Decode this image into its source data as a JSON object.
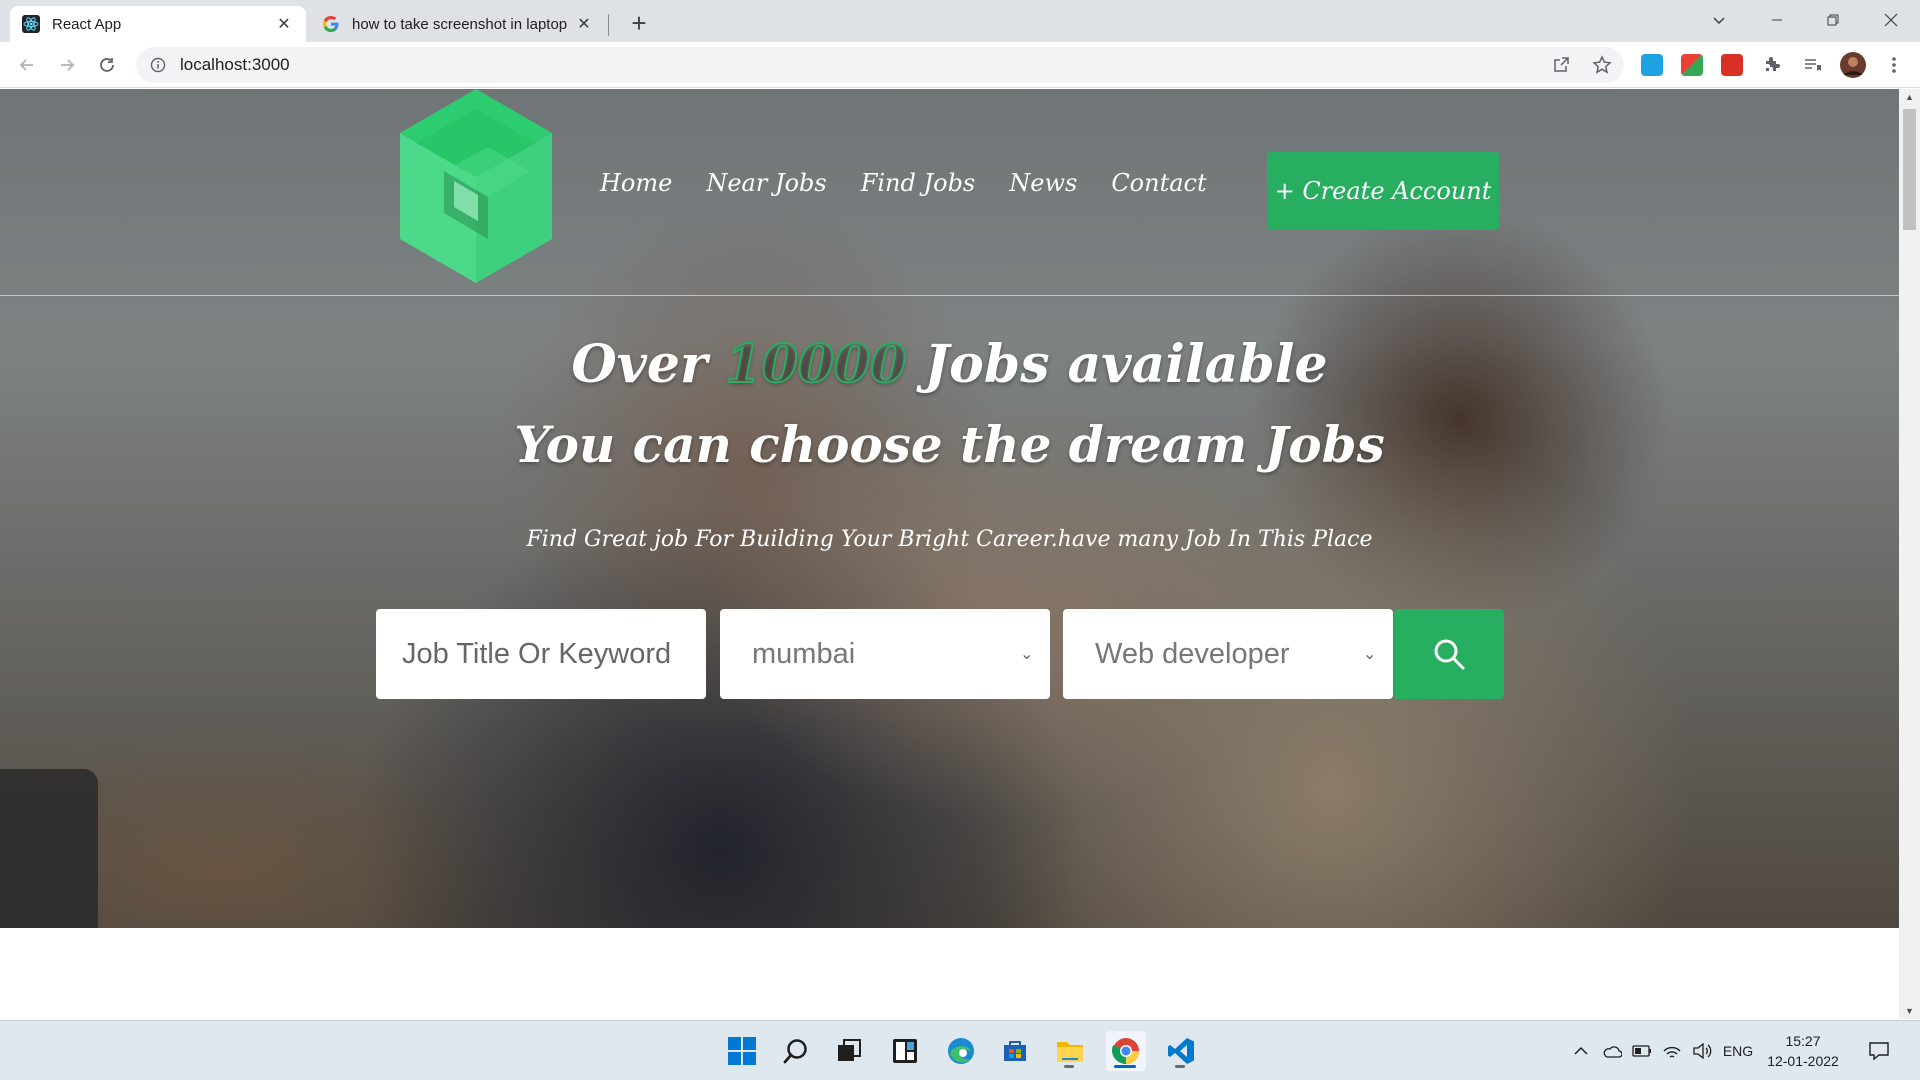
{
  "browser": {
    "tabs": [
      {
        "title": "React App",
        "active": true
      },
      {
        "title": "how to take screenshot in laptop",
        "active": false
      }
    ],
    "url": "localhost:3000"
  },
  "site": {
    "nav": [
      "Home",
      "Near Jobs",
      "Find Jobs",
      "News",
      "Contact"
    ],
    "create_account": "+ Create Account",
    "headline_pre": "Over ",
    "headline_number": "10000",
    "headline_post": " Jobs available",
    "subheadline": "You can choose the dream Jobs",
    "tagline": "Find Great job For Building Your Bright Career.have many Job In This Place",
    "search": {
      "keyword_placeholder": "Job Title Or Keyword",
      "location_value": "mumbai",
      "category_value": "Web developer"
    },
    "colors": {
      "accent": "#27ae60"
    }
  },
  "taskbar": {
    "apps": [
      "start-icon",
      "search-icon",
      "task-view-icon",
      "widgets-icon",
      "edge-icon",
      "store-icon",
      "file-explorer-icon",
      "chrome-icon",
      "vscode-icon"
    ],
    "language": "ENG",
    "time": "15:27",
    "date": "12-01-2022"
  }
}
